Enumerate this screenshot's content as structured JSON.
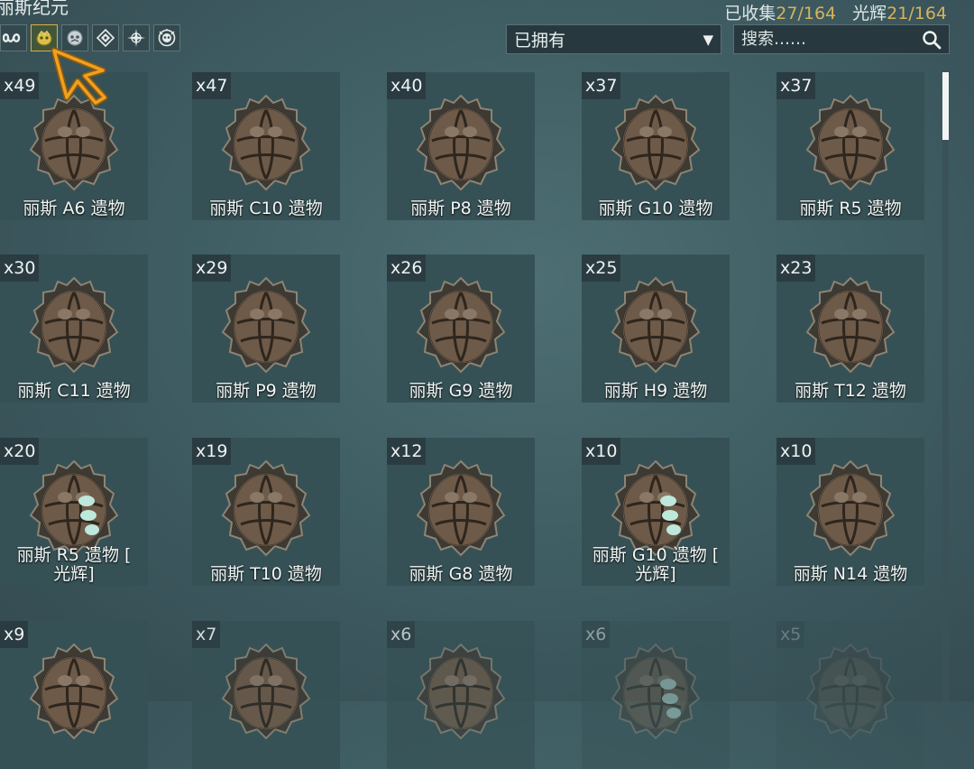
{
  "header": {
    "era_title": "丽斯纪元",
    "collected_label": "已收集",
    "collected_value": "27/164",
    "radiant_label": "光辉",
    "radiant_value": "21/164"
  },
  "filters": [
    {
      "icon": "infinity-icon"
    },
    {
      "icon": "lith-relic-icon",
      "active": true
    },
    {
      "icon": "meso-relic-icon"
    },
    {
      "icon": "neo-relic-icon"
    },
    {
      "icon": "axi-relic-icon"
    },
    {
      "icon": "requiem-relic-icon"
    }
  ],
  "owned_filter": {
    "selected": "已拥有"
  },
  "search": {
    "placeholder": "搜索……"
  },
  "relics": [
    {
      "count": "x49",
      "name": "丽斯 A6 遗物",
      "radiant": false
    },
    {
      "count": "x47",
      "name": "丽斯 C10 遗物",
      "radiant": false
    },
    {
      "count": "x40",
      "name": "丽斯 P8 遗物",
      "radiant": false
    },
    {
      "count": "x37",
      "name": "丽斯 G10 遗物",
      "radiant": false
    },
    {
      "count": "x37",
      "name": "丽斯 R5 遗物",
      "radiant": false
    },
    {
      "count": "x30",
      "name": "丽斯 C11 遗物",
      "radiant": false
    },
    {
      "count": "x29",
      "name": "丽斯 P9 遗物",
      "radiant": false
    },
    {
      "count": "x26",
      "name": "丽斯 G9 遗物",
      "radiant": false
    },
    {
      "count": "x25",
      "name": "丽斯 H9 遗物",
      "radiant": false
    },
    {
      "count": "x23",
      "name": "丽斯 T12 遗物",
      "radiant": false
    },
    {
      "count": "x20",
      "name": "丽斯 R5 遗物 [\n光辉]",
      "radiant": true
    },
    {
      "count": "x19",
      "name": "丽斯 T10 遗物",
      "radiant": false
    },
    {
      "count": "x12",
      "name": "丽斯 G8 遗物",
      "radiant": false
    },
    {
      "count": "x10",
      "name": "丽斯 G10 遗物 [\n光辉]",
      "radiant": true
    },
    {
      "count": "x10",
      "name": "丽斯 N14 遗物",
      "radiant": false
    },
    {
      "count": "x9",
      "name": "",
      "radiant": false
    },
    {
      "count": "x7",
      "name": "",
      "radiant": false
    },
    {
      "count": "x6",
      "name": "",
      "radiant": false
    },
    {
      "count": "x6",
      "name": "",
      "radiant": true
    },
    {
      "count": "x5",
      "name": "",
      "radiant": false
    }
  ],
  "colors": {
    "accent": "#d8b25d",
    "cursor": "#f0a020",
    "background": "#3f5e64"
  }
}
